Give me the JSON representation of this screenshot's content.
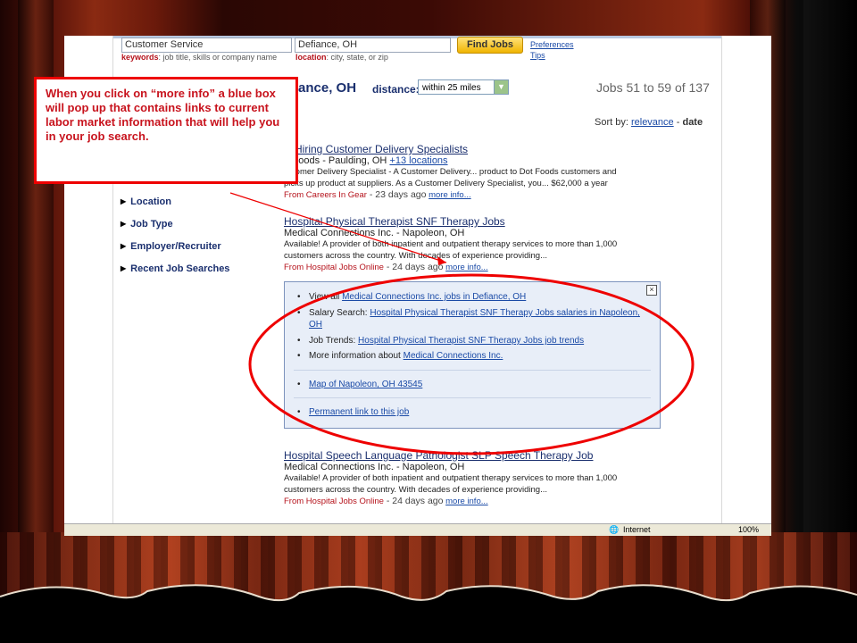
{
  "search": {
    "keywords_value": "Customer Service",
    "location_value": "Defiance, OH",
    "find_button": "Find Jobs",
    "keywords_hint_label": "keywords",
    "keywords_hint_text": ": job title, skills or company name",
    "location_hint_label": "location",
    "location_hint_text": ": city, state, or zip",
    "preferences_link": "Preferences",
    "tips_link": "Tips"
  },
  "results_header": {
    "location_heading": "ance, OH",
    "distance_label": "distance:",
    "distance_value": "within 25 miles",
    "jobs_count": "Jobs 51 to 59 of 137",
    "sort_label": "Sort by:",
    "sort_relevance": "relevance",
    "sort_separator": "-",
    "sort_date": "date"
  },
  "facets": [
    {
      "label": "Location"
    },
    {
      "label": "Job Type"
    },
    {
      "label": "Employer/Recruiter"
    },
    {
      "label": "Recent Job Searches"
    }
  ],
  "jobs": [
    {
      "title": "w Hiring Customer Delivery Specialists",
      "company": "T Foods - Paulding, OH",
      "extra_link": "+13 locations",
      "desc1": "ustomer Delivery Specialist - A Customer Delivery... product to Dot Foods customers and",
      "desc2": "picks up product at suppliers.  As a Customer Delivery Specialist, you... $62,000 a year",
      "source": "From Careers In Gear",
      "age": " - 23 days ago",
      "more": "more info..."
    },
    {
      "title": "Hospital Physical Therapist SNF Therapy Jobs",
      "company": "Medical Connections Inc. - Napoleon, OH",
      "desc1": "Available! A provider of both inpatient and outpatient therapy services to more than 1,000",
      "desc2": "customers across the country. With decades of experience providing...",
      "source": "From Hospital Jobs Online",
      "age": " - 24 days ago",
      "more": "more info..."
    },
    {
      "title": "Hospital Speech Language Pathologist SLP Speech Therapy Job",
      "company": "Medical Connections Inc. - Napoleon, OH",
      "desc1": "Available! A provider of both inpatient and outpatient therapy services to more than 1,000",
      "desc2": "customers across the country. With decades of experience providing...",
      "source": "From Hospital Jobs Online",
      "age": " - 24 days ago",
      "more": "more info..."
    }
  ],
  "more_info_box": {
    "close": "×",
    "view_all_prefix": "View all ",
    "view_all_link": "Medical Connections Inc. jobs in Defiance, OH",
    "salary_prefix": "Salary Search: ",
    "salary_link": "Hospital Physical Therapist SNF Therapy Jobs salaries in Napoleon, OH",
    "trends_prefix": "Job Trends: ",
    "trends_link": "Hospital Physical Therapist SNF Therapy Jobs job trends",
    "moreinfo_prefix": "More information about ",
    "moreinfo_link": "Medical Connections Inc.",
    "map_link": "Map of Napoleon, OH 43545",
    "permalink": "Permanent link to this job"
  },
  "statusbar": {
    "zone": "Internet",
    "zoom": "100%"
  },
  "callout": {
    "text": "When you click on “more info” a blue box will pop up that contains links to current labor market information that will help you in your job search."
  },
  "colors": {
    "callout_red": "#e00000",
    "link_blue": "#1a4aa6",
    "box_blue": "#e8eef8"
  }
}
